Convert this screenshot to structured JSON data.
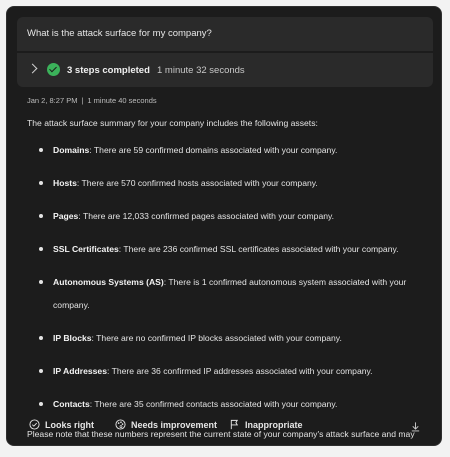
{
  "question": "What is the attack surface for my company?",
  "steps": {
    "label": "3 steps completed",
    "duration": "1 minute 32 seconds"
  },
  "meta": {
    "date": "Jan 2, 8:27 PM",
    "elapsed": "1 minute 40 seconds"
  },
  "intro": "The attack surface summary for your company includes the following assets:",
  "assets": [
    {
      "name": "Domains",
      "text": ": There are 59 confirmed domains associated with your company."
    },
    {
      "name": "Hosts",
      "text": ": There are 570 confirmed hosts associated with your company."
    },
    {
      "name": "Pages",
      "text": ": There are 12,033 confirmed pages associated with your company."
    },
    {
      "name": "SSL Certificates",
      "text": ": There are 236 confirmed SSL certificates associated with your company."
    },
    {
      "name": "Autonomous Systems (AS)",
      "text": ": There is 1 confirmed autonomous system associated with your company."
    },
    {
      "name": "IP Blocks",
      "text": ": There are no confirmed IP blocks associated with your company."
    },
    {
      "name": "IP Addresses",
      "text": ": There are 36 confirmed IP addresses associated with your company."
    },
    {
      "name": "Contacts",
      "text": ": There are 35 confirmed contacts associated with your company."
    }
  ],
  "note": "Please note that these numbers represent the current state of your company's attack surface and may change over time as new assets are discovered or existing ones are removed.",
  "feedback": {
    "looks_right": "Looks right",
    "needs_improvement": "Needs improvement",
    "inappropriate": "Inappropriate"
  },
  "icons": {
    "check": "check-circle-icon",
    "chevron": "chevron-right-icon",
    "download": "download-icon",
    "flag": "flag-icon",
    "palette": "palette-icon"
  },
  "colors": {
    "success": "#3bb25a",
    "panel_bg": "#1c1c1c"
  }
}
